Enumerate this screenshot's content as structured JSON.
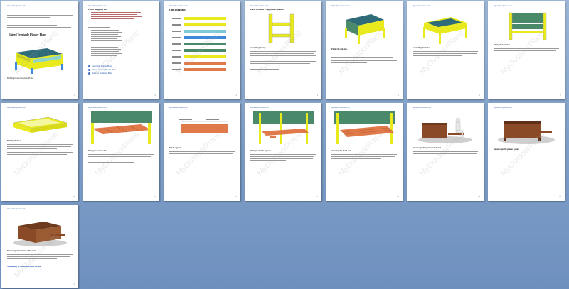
{
  "viewer": {
    "page_count": 15
  },
  "pages": [
    {
      "number": "1",
      "header": "myoutdoorplans.com",
      "watermark": "MyOutdoorPlans",
      "title": "Raised Vegetable Planter Plans",
      "caption": "Building a Raised Vegetable Planter"
    },
    {
      "number": "2",
      "header": "myoutdoorplans.com",
      "watermark": "MyOutdoorPlans",
      "title": "Cut & Shopping List",
      "links": [
        "Vegetable Planter Plans",
        "Raised Garden Planter Plans",
        "Outdoor Furniture Plans"
      ]
    },
    {
      "number": "3",
      "header": "myoutdoorplans.com",
      "watermark": "MyOutdoorPlans",
      "title": "Cut Diagram"
    },
    {
      "number": "4",
      "header": "myoutdoorplans.com",
      "watermark": "MyOutdoorPlans",
      "title": "How to build a vegetable planter",
      "caption": "Assembling the legs"
    },
    {
      "number": "5",
      "header": "myoutdoorplans.com",
      "watermark": "MyOutdoorPlans",
      "caption": "Fitting the side slats"
    },
    {
      "number": "6",
      "header": "myoutdoorplans.com",
      "watermark": "MyOutdoorPlans",
      "caption": "Assembling the frame"
    },
    {
      "number": "7",
      "header": "myoutdoorplans.com",
      "watermark": "MyOutdoorPlans",
      "caption": "Fitting the back slats"
    },
    {
      "number": "8",
      "header": "myoutdoorplans.com",
      "watermark": "MyOutdoorPlans",
      "caption": "Building the base"
    },
    {
      "number": "9",
      "header": "myoutdoorplans.com",
      "watermark": "MyOutdoorPlans",
      "caption": "Fitting the bottom slats"
    },
    {
      "number": "10",
      "header": "myoutdoorplans.com",
      "watermark": "MyOutdoorPlans",
      "caption": "Bench supports"
    },
    {
      "number": "11",
      "header": "myoutdoorplans.com",
      "watermark": "MyOutdoorPlans",
      "caption": "Fitting the bench supports"
    },
    {
      "number": "12",
      "header": "myoutdoorplans.com",
      "watermark": "MyOutdoorPlans",
      "caption": "Attaching the bench slats"
    },
    {
      "number": "13",
      "header": "myoutdoorplans.com",
      "watermark": "MyOutdoorPlans",
      "caption": "Raised vegetable planter with bench"
    },
    {
      "number": "14",
      "header": "myoutdoorplans.com",
      "watermark": "MyOutdoorPlans",
      "caption": "Raised vegetable planter - plans"
    },
    {
      "number": "15",
      "header": "myoutdoorplans.com",
      "watermark": "MyOutdoorPlans",
      "caption": "Raised vegetable planter with bench",
      "footer": "See all my Premium Plans HERE"
    }
  ],
  "colors": {
    "background_top": "#9db6d6",
    "background_bottom": "#6e90bf",
    "yellow": "#e8ea1e",
    "green": "#4a8a6a",
    "orange": "#e07a4a",
    "blue_link": "#1a4fb0",
    "wood": "#8a4a28"
  }
}
